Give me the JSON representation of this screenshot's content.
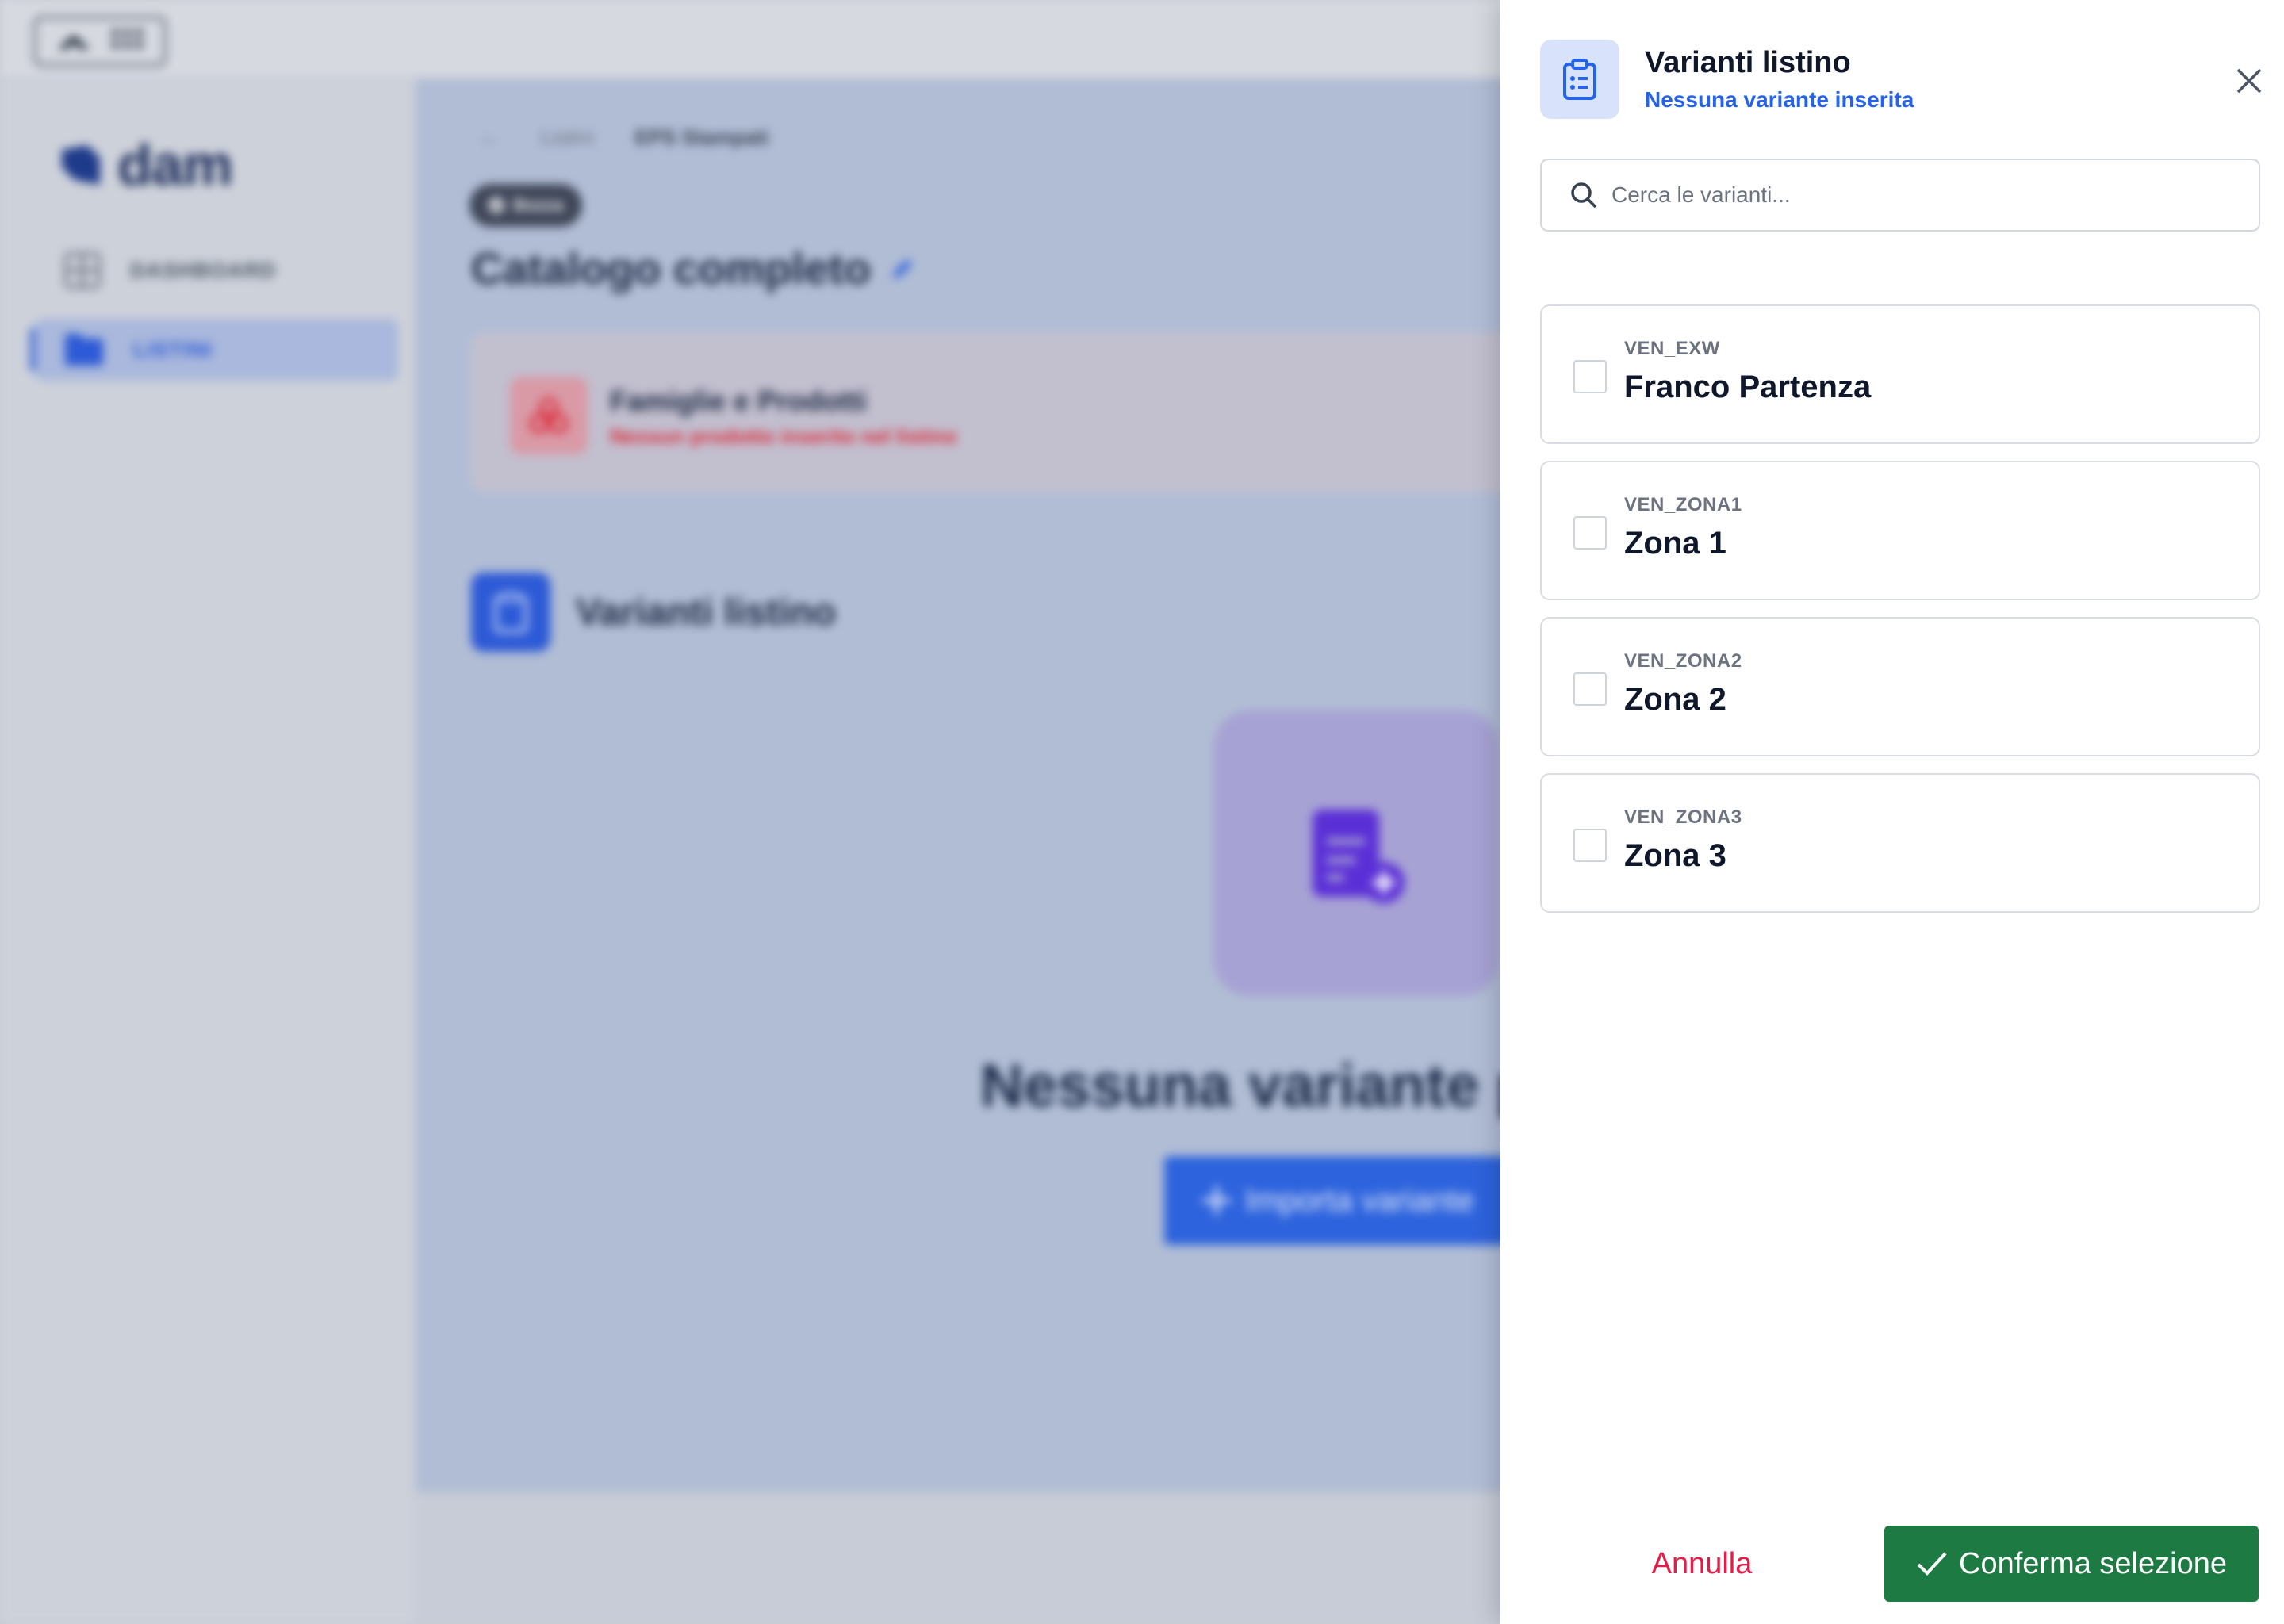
{
  "app": {
    "logo_text": "dam",
    "sidebar": [
      {
        "label": "DASHBOARD",
        "icon": "grid-icon"
      },
      {
        "label": "LISTINI",
        "icon": "folder-icon"
      }
    ],
    "breadcrumb": {
      "back": "←",
      "items": [
        "Listini",
        "EPS Stampati"
      ]
    },
    "status_badge": "Bozza",
    "page_title": "Catalogo completo",
    "families_card": {
      "title": "Famiglie e Prodotti",
      "subtitle": "Nessun prodotto inserito nel listino"
    },
    "variants_section": {
      "title": "Varianti listino"
    },
    "empty_state": {
      "title": "Nessuna variante presente",
      "import_button": "Importa variante"
    }
  },
  "drawer": {
    "title": "Varianti listino",
    "subtitle": "Nessuna variante inserita",
    "search_placeholder": "Cerca le varianti...",
    "variants": [
      {
        "code": "VEN_EXW",
        "name": "Franco Partenza",
        "checked": false
      },
      {
        "code": "VEN_ZONA1",
        "name": "Zona 1",
        "checked": false
      },
      {
        "code": "VEN_ZONA2",
        "name": "Zona 2",
        "checked": false
      },
      {
        "code": "VEN_ZONA3",
        "name": "Zona 3",
        "checked": false
      }
    ],
    "cancel_label": "Annulla",
    "confirm_label": "Conferma selezione"
  },
  "colors": {
    "primary": "#2563eb",
    "confirm": "#1e7a43",
    "cancel": "#e11d48",
    "danger": "#dc2a3a",
    "overlay": "#b1bdd5"
  }
}
